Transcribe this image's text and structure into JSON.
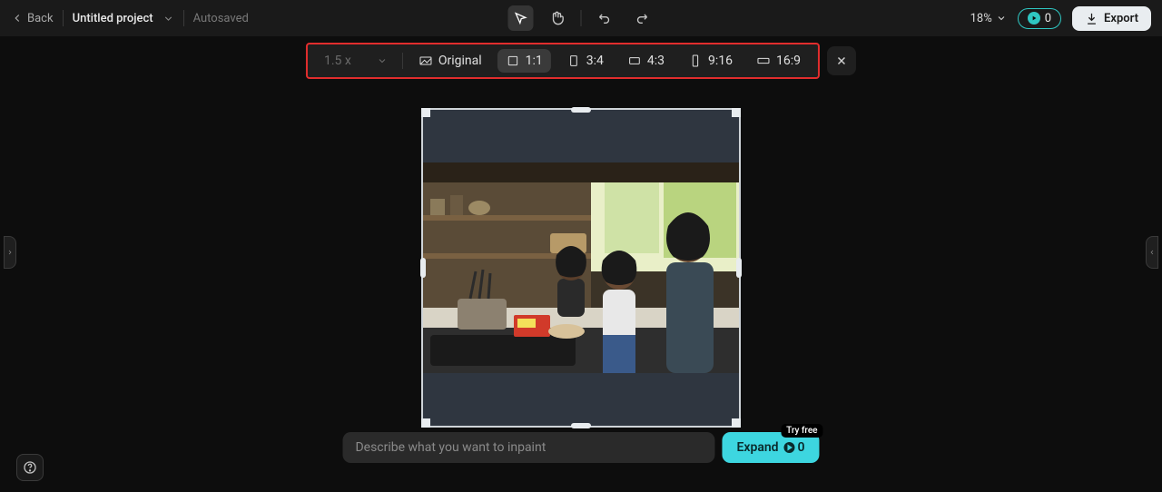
{
  "topbar": {
    "back": "Back",
    "project_name": "Untitled project",
    "autosaved": "Autosaved",
    "zoom": "18%",
    "credits": "0",
    "export": "Export"
  },
  "aspect": {
    "scale": "1.5 x",
    "original": "Original",
    "r11": "1:1",
    "r34": "3:4",
    "r43": "4:3",
    "r916": "9:16",
    "r169": "16:9"
  },
  "prompt": {
    "placeholder": "Describe what you want to inpaint",
    "expand": "Expand",
    "badge": "Try free",
    "credit_cost": "0"
  }
}
